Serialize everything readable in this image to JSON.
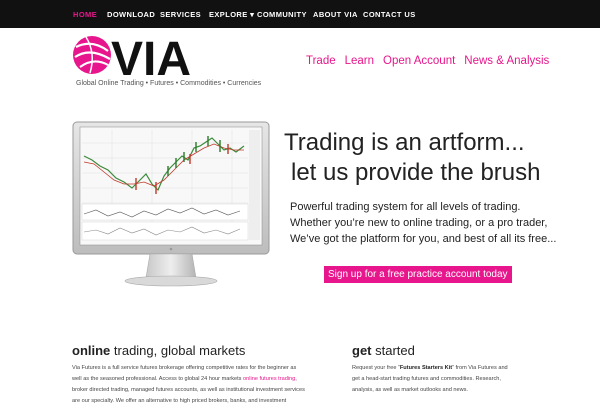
{
  "topnav": {
    "items": [
      {
        "label": "HOME",
        "active": true
      },
      {
        "label": "DOWNLOAD"
      },
      {
        "label": "SERVICES"
      },
      {
        "label": "EXPLORE ▾"
      },
      {
        "label": "COMMUNITY"
      },
      {
        "label": "ABOUT VIA"
      },
      {
        "label": "CONTACT US"
      }
    ]
  },
  "brand": {
    "logo_text": "VIA",
    "tagline": "Global Online Trading • Futures • Commodities • Currencies",
    "accent": "#e8168c"
  },
  "secnav": {
    "items": [
      "Trade",
      "Learn",
      "Open Account",
      "News & Analysis"
    ]
  },
  "hero": {
    "title_line1": "Trading is an artform...",
    "title_line2": "let us provide the brush",
    "body_line1": "Powerful trading system for all levels of trading.",
    "body_line2": "Whether you’re new to online trading, or a pro trader,",
    "body_line3": "We’ve got the platform for you, and best of all its free...",
    "cta": "Sign up for a free practice account today"
  },
  "online_section": {
    "title_bold": "online",
    "title_rest": " trading, global markets",
    "line1": "Via Futures is a full service futures brokerage offering competitive rates for the beginner as",
    "line2": "well as the seasoned professional. Access to global 24 hour markets ",
    "line2_link": "online futures trading",
    "line2_end": ",",
    "line3": "broker directed trading, managed futures accounts, as well as institutional investment services",
    "line4": "are our specialty. We offer an alternative to high priced brokers, banks, and investment"
  },
  "started_section": {
    "title_bold": "get",
    "title_rest": " started",
    "line1a": "Request your free “",
    "line1b": "Futures Starters Kit",
    "line1c": "” from Via Futures and",
    "line2": "get a head-start trading futures and commodities. Research,",
    "line3": "analysis, as well as market outlooks and news."
  }
}
